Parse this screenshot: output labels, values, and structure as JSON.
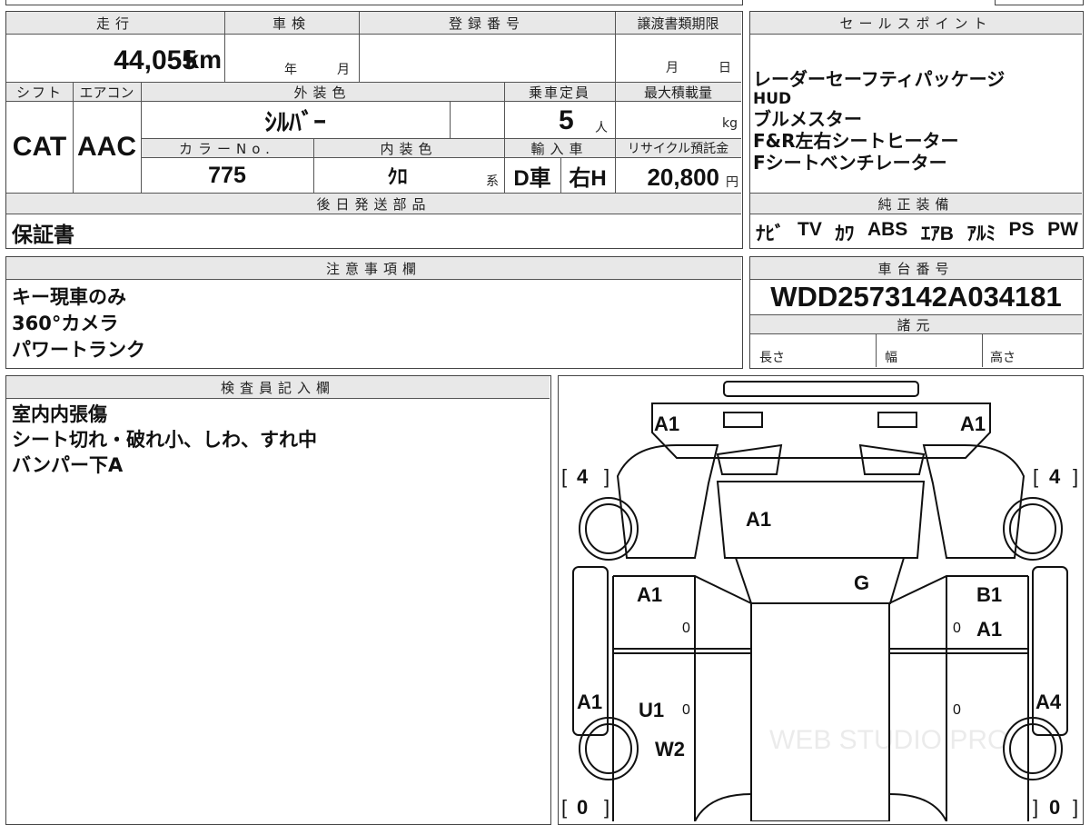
{
  "headers": {
    "mileage": "走行",
    "inspection": "車検",
    "registration_no": "登録番号",
    "transfer_deadline": "譲渡書類期限",
    "shift": "シフト",
    "aircon": "エアコン",
    "exterior_color": "外装色",
    "capacity": "乗車定員",
    "max_load": "最大積載量",
    "color_no": "カラーNo.",
    "interior_color": "内装色",
    "import": "輸入車",
    "recycle": "リサイクル預託金",
    "later_parts": "後日発送部品",
    "sales_points": "セールスポイント",
    "genuine_equipment": "純正装備",
    "notes": "注意事項欄",
    "chassis_no": "車台番号",
    "specs": "諸元",
    "inspector_notes": "検査員記入欄"
  },
  "vehicle": {
    "mileage": "44,055",
    "mileage_unit": "km",
    "year_unit": "年",
    "month_unit": "月",
    "deadline_month": "月",
    "deadline_day": "日",
    "shift": "CAT",
    "aircon": "AAC",
    "exterior_color": "ｼﾙﾊﾞｰ",
    "capacity": "5",
    "capacity_unit": "人",
    "load_unit": "kg",
    "color_no": "775",
    "interior_color": "ｸﾛ",
    "interior_suffix": "系",
    "import_type": "D車",
    "handle": "右H",
    "recycle_fee": "20,800",
    "recycle_unit": "円",
    "later_parts": "保証書",
    "chassis_no": "WDD2573142A034181"
  },
  "sales_points": [
    "レーダーセーフティパッケージ",
    "HUD",
    "ブルメスター",
    "F&R左右シートヒーター",
    "Fシートベンチレーター"
  ],
  "equipment": [
    "ﾅﾋﾞ",
    "TV",
    "ｶﾜ",
    "ABS",
    "ｴｱB",
    "ｱﾙﾐ",
    "PS",
    "PW"
  ],
  "notes": [
    "キー現車のみ",
    "360°カメラ",
    "パワートランク"
  ],
  "specs": {
    "length": "長さ",
    "width": "幅",
    "height": "高さ"
  },
  "inspector_notes": [
    "室内内張傷",
    "シート切れ・破れ小、しわ、すれ中",
    "バンパー下A"
  ],
  "diagram": {
    "marks": {
      "front_left": "A1",
      "front_right": "A1",
      "hood": "A1",
      "windshield": "G",
      "front_door_left": "A1",
      "front_door_right_1": "B1",
      "front_door_right_2": "A1",
      "left_side": "A1",
      "rear_door_left_1": "U1",
      "rear_door_left_2": "W2",
      "right_side": "A4"
    },
    "tires": {
      "front_left": "4",
      "front_right": "4",
      "rear_left": "0",
      "rear_right": "0"
    },
    "zeros": [
      "0",
      "0",
      "0",
      "0"
    ],
    "watermark": "WEB STUDIO PRO"
  }
}
